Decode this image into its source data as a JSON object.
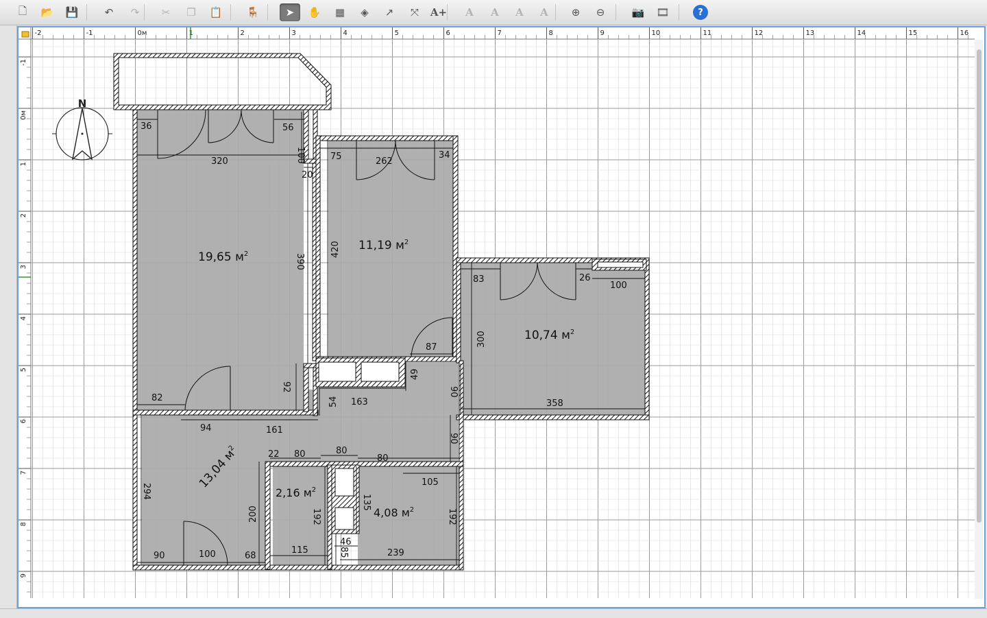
{
  "toolbar": {
    "buttons": [
      {
        "id": "new",
        "name": "new-file-icon",
        "glyph": "🗋",
        "state": "normal"
      },
      {
        "id": "open",
        "name": "open-folder-icon",
        "glyph": "📂",
        "state": "normal"
      },
      {
        "id": "save",
        "name": "save-icon",
        "glyph": "💾",
        "state": "normal"
      },
      {
        "id": "undo",
        "name": "undo-icon",
        "glyph": "↶",
        "state": "normal"
      },
      {
        "id": "redo",
        "name": "redo-icon",
        "glyph": "↷",
        "state": "disabled"
      },
      {
        "id": "cut",
        "name": "cut-icon",
        "glyph": "✂",
        "state": "disabled"
      },
      {
        "id": "copy",
        "name": "copy-icon",
        "glyph": "❐",
        "state": "disabled"
      },
      {
        "id": "paste",
        "name": "paste-icon",
        "glyph": "📋",
        "state": "normal"
      },
      {
        "id": "add-furniture",
        "name": "add-furniture-icon",
        "glyph": "🪑",
        "state": "normal"
      },
      {
        "id": "select",
        "name": "select-pointer-icon",
        "glyph": "➤",
        "state": "active"
      },
      {
        "id": "pan",
        "name": "pan-hand-icon",
        "glyph": "✋",
        "state": "normal"
      },
      {
        "id": "create-walls",
        "name": "create-walls-icon",
        "glyph": "▦",
        "state": "normal"
      },
      {
        "id": "create-rooms",
        "name": "create-rooms-icon",
        "glyph": "◈",
        "state": "normal"
      },
      {
        "id": "create-polylines",
        "name": "create-polylines-icon",
        "glyph": "↗",
        "state": "normal"
      },
      {
        "id": "create-dimensions",
        "name": "create-dimensions-icon",
        "glyph": "⤧",
        "state": "normal"
      },
      {
        "id": "add-text",
        "name": "add-text-icon",
        "glyph": "A+",
        "state": "normal"
      },
      {
        "id": "text-increase",
        "name": "text-increase-icon",
        "glyph": "A",
        "state": "disabled"
      },
      {
        "id": "text-decrease",
        "name": "text-decrease-icon",
        "glyph": "A",
        "state": "disabled"
      },
      {
        "id": "text-bold",
        "name": "text-bold-icon",
        "glyph": "A",
        "state": "disabled"
      },
      {
        "id": "text-italic",
        "name": "text-italic-icon",
        "glyph": "A",
        "state": "disabled"
      },
      {
        "id": "zoom-in",
        "name": "zoom-in-icon",
        "glyph": "⊕",
        "state": "normal"
      },
      {
        "id": "zoom-out",
        "name": "zoom-out-icon",
        "glyph": "⊖",
        "state": "normal"
      },
      {
        "id": "photo",
        "name": "create-photo-icon",
        "glyph": "📷",
        "state": "normal"
      },
      {
        "id": "video",
        "name": "create-video-icon",
        "glyph": "🎞",
        "state": "normal"
      },
      {
        "id": "help",
        "name": "help-icon",
        "glyph": "?",
        "state": "normal"
      }
    ]
  },
  "plan": {
    "ruler_x": [
      "-2",
      "-1",
      "0м",
      "1",
      "2",
      "3",
      "4",
      "5",
      "6",
      "7",
      "8",
      "9",
      "10",
      "11",
      "12",
      "13",
      "14",
      "15",
      "16"
    ],
    "ruler_y": [
      "-1",
      "0м",
      "1",
      "2",
      "3",
      "4",
      "5",
      "6",
      "7",
      "8",
      "9"
    ],
    "compass_label": "N",
    "rooms": [
      {
        "id": "room-1",
        "area": "19,65 м",
        "sup": "2"
      },
      {
        "id": "room-2",
        "area": "11,19 м",
        "sup": "2"
      },
      {
        "id": "room-3",
        "area": "10,74 м",
        "sup": "2"
      },
      {
        "id": "room-4",
        "area": "13,04 м",
        "sup": "2"
      },
      {
        "id": "room-5",
        "area": "2,16 м",
        "sup": "2"
      },
      {
        "id": "room-6",
        "area": "4,08 м",
        "sup": "2"
      }
    ],
    "dimensions": [
      "36",
      "56",
      "100",
      "320",
      "20",
      "75",
      "262",
      "34",
      "390",
      "420",
      "83",
      "26",
      "100",
      "300",
      "87",
      "82",
      "92",
      "49",
      "54",
      "163",
      "90",
      "358",
      "94",
      "161",
      "90",
      "22",
      "80",
      "80",
      "80",
      "105",
      "294",
      "200",
      "192",
      "135",
      "192",
      "46",
      "85",
      "90",
      "100",
      "68",
      "115",
      "239"
    ]
  },
  "colors": {
    "accent": "#6f9fd8",
    "room_fill": "#a9a9a9",
    "grid_major": "#9a9a9a",
    "grid_minor": "#d8d8d8",
    "wall": "#1a1a1a"
  }
}
